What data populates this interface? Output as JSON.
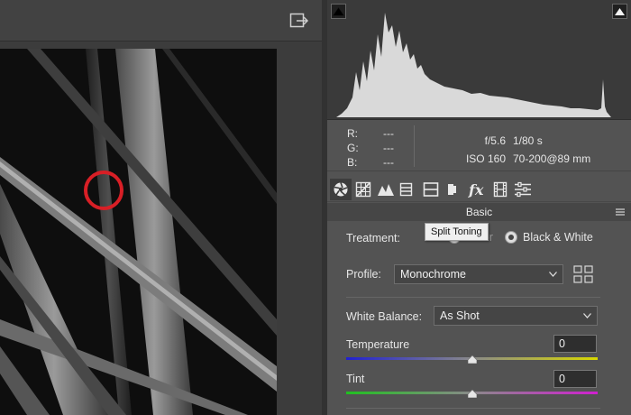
{
  "histogram": {
    "left_clip_icon": "shadow-clipping-triangle-icon",
    "right_clip_icon": "highlight-clipping-triangle-icon"
  },
  "readout": {
    "r_label": "R:",
    "r_value": "---",
    "g_label": "G:",
    "g_value": "---",
    "b_label": "B:",
    "b_value": "---"
  },
  "exif": {
    "aperture": "f/5.6",
    "shutter": "1/80 s",
    "iso": "ISO 160",
    "lens": "70-200@89 mm"
  },
  "tabs": [
    {
      "icon": "aperture-icon"
    },
    {
      "icon": "tone-curve-grid-icon"
    },
    {
      "icon": "mountains-detail-icon"
    },
    {
      "icon": "hsl-icon"
    },
    {
      "icon": "split-toning-icon"
    },
    {
      "icon": "lens-icon"
    },
    {
      "icon": "fx-icon"
    },
    {
      "icon": "film-strip-icon"
    },
    {
      "icon": "sliders-icon"
    }
  ],
  "section": {
    "title": "Basic"
  },
  "tooltip": {
    "text": "Split Toning"
  },
  "treatment": {
    "label": "Treatment:",
    "color_option": "Color",
    "bw_option": "Black & White"
  },
  "profile": {
    "label": "Profile:",
    "value": "Monochrome"
  },
  "white_balance": {
    "label": "White Balance:",
    "value": "As Shot"
  },
  "temperature": {
    "label": "Temperature",
    "value": "0",
    "level": 0.5
  },
  "tint": {
    "label": "Tint",
    "value": "0",
    "level": 0.5
  },
  "colors": {
    "highlight_ring": "#d81f26",
    "temp_blue": "#2020d0",
    "temp_yellow": "#d8d800",
    "tint_green": "#20c020",
    "tint_magenta": "#d020d0"
  }
}
